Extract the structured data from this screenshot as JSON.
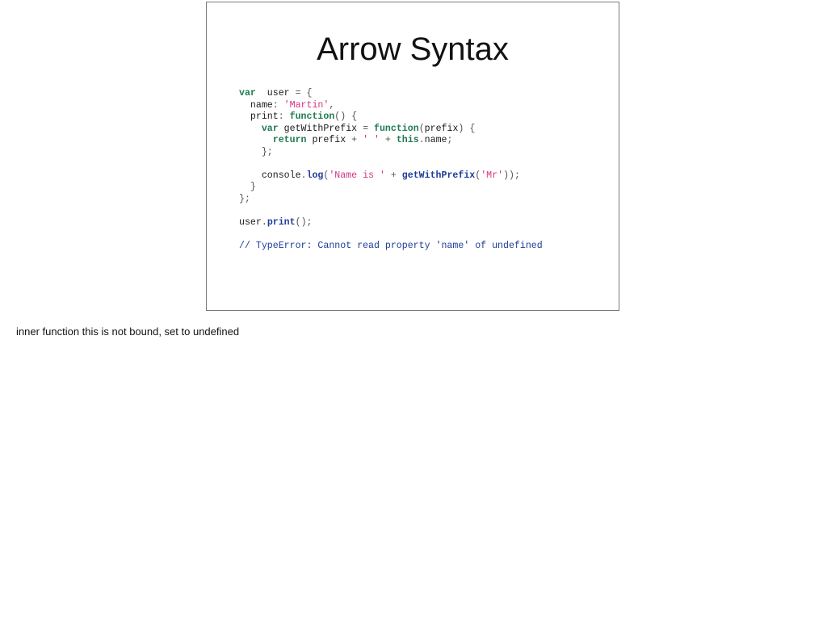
{
  "slide": {
    "title": "Arrow Syntax",
    "code_lines": [
      [
        [
          "kw",
          "var"
        ],
        [
          "",
          "  user "
        ],
        [
          "pn",
          "="
        ],
        [
          "pn",
          " {"
        ]
      ],
      [
        [
          "",
          "  name"
        ],
        [
          "pn",
          ": "
        ],
        [
          "str",
          "'Martin'"
        ],
        [
          "pn",
          ","
        ]
      ],
      [
        [
          "",
          "  print"
        ],
        [
          "pn",
          ": "
        ],
        [
          "kw",
          "function"
        ],
        [
          "pn",
          "() {"
        ]
      ],
      [
        [
          "",
          "    "
        ],
        [
          "kw",
          "var"
        ],
        [
          "",
          "",
          " getWithPrefix "
        ],
        [
          "pn",
          "= "
        ],
        [
          "kw",
          "function"
        ],
        [
          "pn",
          "("
        ],
        [
          "",
          "prefix"
        ],
        [
          "pn",
          ") {"
        ]
      ],
      [
        [
          "",
          "      "
        ],
        [
          "kw",
          "return"
        ],
        [
          "",
          " prefix "
        ],
        [
          "pn",
          "+ "
        ],
        [
          "str",
          "' '"
        ],
        [
          "pn",
          " + "
        ],
        [
          "kw",
          "this"
        ],
        [
          "pn",
          "."
        ],
        [
          "",
          "name"
        ],
        [
          "pn",
          ";"
        ]
      ],
      [
        [
          "pn",
          "    };"
        ]
      ],
      [
        [
          "",
          ""
        ]
      ],
      [
        [
          "",
          "    console"
        ],
        [
          "pn",
          "."
        ],
        [
          "fn",
          "log"
        ],
        [
          "pn",
          "("
        ],
        [
          "str",
          "'Name is '"
        ],
        [
          "pn",
          " + "
        ],
        [
          "fn",
          "getWithPrefix"
        ],
        [
          "pn",
          "("
        ],
        [
          "str",
          "'Mr'"
        ],
        [
          "pn",
          "));"
        ]
      ],
      [
        [
          "pn",
          "  }"
        ]
      ],
      [
        [
          "pn",
          "};"
        ]
      ],
      [
        [
          "",
          ""
        ]
      ],
      [
        [
          "",
          "user"
        ],
        [
          "pn",
          "."
        ],
        [
          "fn",
          "print"
        ],
        [
          "pn",
          "();"
        ]
      ],
      [
        [
          "",
          ""
        ]
      ],
      [
        [
          "cm",
          "// TypeError: Cannot read property 'name' of undefined"
        ]
      ]
    ]
  },
  "notes": {
    "text": "inner function this is not bound, set to undefined"
  }
}
